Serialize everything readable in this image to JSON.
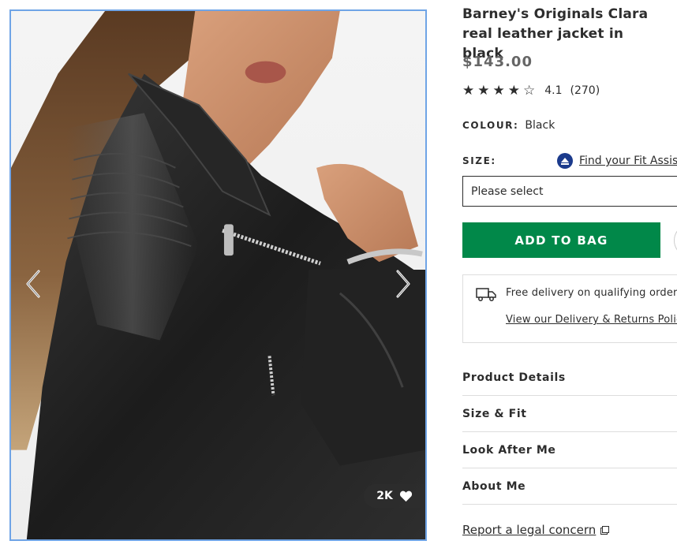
{
  "product": {
    "title": "Barney's Originals Clara real leather jacket in black",
    "price": "$143.00",
    "rating": {
      "value": "4.1",
      "count": "(270)",
      "stars": [
        "★",
        "★",
        "★",
        "★",
        "☆"
      ]
    },
    "colour": {
      "label": "COLOUR:",
      "value": "Black"
    },
    "size": {
      "label": "SIZE:",
      "fit_link": "Find your Fit Assistant",
      "select_placeholder": "Please select"
    },
    "add_to_bag": "ADD TO BAG",
    "delivery": {
      "free_text": "Free delivery on qualifying orders.",
      "policy_link": "View our Delivery & Returns Policy"
    },
    "accordion": [
      {
        "label": "Product Details"
      },
      {
        "label": "Size & Fit"
      },
      {
        "label": "Look After Me"
      },
      {
        "label": "About Me"
      }
    ],
    "legal_link": "Report a legal concern"
  },
  "gallery": {
    "saves_count": "2K",
    "icons": {
      "prev": "chevron-left-icon",
      "next": "chevron-right-icon",
      "saves": "heart-icon",
      "fit": "fit-assistant-icon",
      "delivery": "truck-icon",
      "legal": "external-link-icon"
    }
  },
  "colors": {
    "accent_green": "#018849",
    "text": "#2d2d2d",
    "price_grey": "#666666",
    "image_border": "#6fa4e6"
  }
}
